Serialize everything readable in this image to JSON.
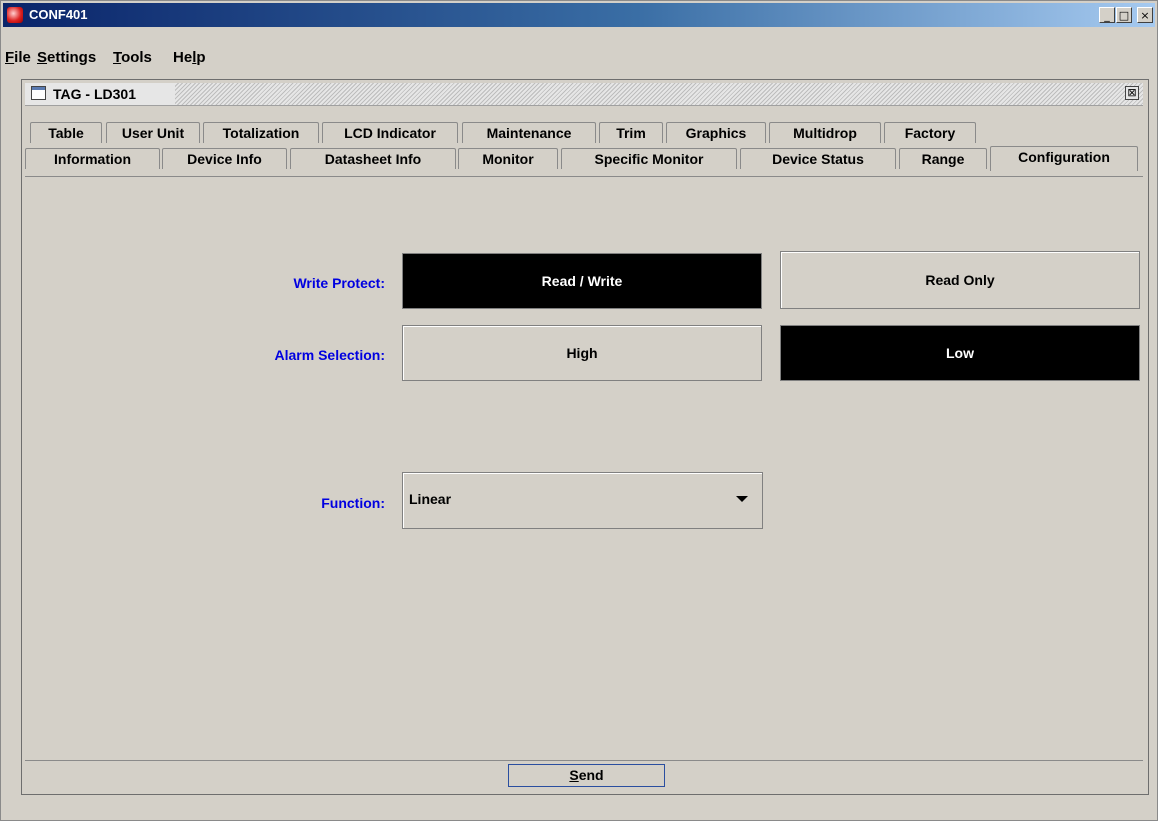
{
  "window": {
    "title": "CONF401",
    "buttons": {
      "minimize": "_",
      "maximize": "□",
      "close": "×"
    },
    "titlebar_colors": [
      "#0a246a",
      "#a6caf0"
    ]
  },
  "menu": {
    "items": [
      {
        "label": "File",
        "mnemonic": "F"
      },
      {
        "label": "Settings",
        "mnemonic": "S"
      },
      {
        "label": "Tools",
        "mnemonic": "T"
      },
      {
        "label": "Help",
        "mnemonic": "l"
      }
    ]
  },
  "frame": {
    "title": "TAG - LD301",
    "close_glyph": "⊠"
  },
  "tabs": {
    "row1": [
      "Table",
      "User Unit",
      "Totalization",
      "LCD Indicator",
      "Maintenance",
      "Trim",
      "Graphics",
      "Multidrop",
      "Factory"
    ],
    "row2": [
      "Information",
      "Device Info",
      "Datasheet Info",
      "Monitor",
      "Specific Monitor",
      "Device Status",
      "Range",
      "Configuration"
    ],
    "selected": "Configuration"
  },
  "config": {
    "write_protect": {
      "label": "Write Protect:",
      "options": [
        "Read / Write",
        "Read Only"
      ],
      "selected": "Read / Write"
    },
    "alarm_selection": {
      "label": "Alarm Selection:",
      "options": [
        "High",
        "Low"
      ],
      "selected": "Low"
    },
    "function": {
      "label": "Function:",
      "value": "Linear"
    },
    "label_color": "#0000e0",
    "selected_color": "#000000"
  },
  "footer": {
    "send_label": "Send",
    "send_mnemonic": "S"
  }
}
